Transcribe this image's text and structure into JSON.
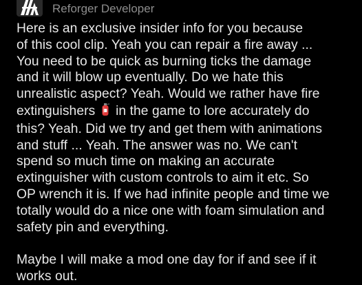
{
  "header": {
    "avatar_icon": "arma-reforger-logo-icon",
    "flair": "Reforger Developer"
  },
  "comment": {
    "paragraph1": {
      "line1": "Here is an exclusive insider info for you because",
      "line2": "of this cool clip. Yeah you can repair a fire away ...",
      "line3": "You need to be quick as burning ticks the damage",
      "line4": "and it will blow up eventually. Do we hate this",
      "line5": "unrealistic aspect? Yeah. Would we rather have fire",
      "line6_before_emoji": "extinguishers",
      "line6_emoji_icon": "fire-extinguisher-icon",
      "line6_after_emoji": "in the game to lore accurately do",
      "line7": "this? Yeah. Did we try and get them with animations",
      "line8": "and stuff ... Yeah. The answer was no. We can't",
      "line9": "spend so much time on making an accurate",
      "line10": "extinguisher with custom controls to aim it etc. So",
      "line11": "OP wrench it is. If we had infinite people and time we",
      "line12": "totally would do a nice one with foam simulation and",
      "line13": "safety pin and everything."
    },
    "paragraph2": {
      "line1": "Maybe I will make a mod one day for if and see if it",
      "line2": "works out."
    }
  },
  "colors": {
    "background": "#000000",
    "text": "#e8e8e8",
    "flair": "#8e8e8e"
  }
}
